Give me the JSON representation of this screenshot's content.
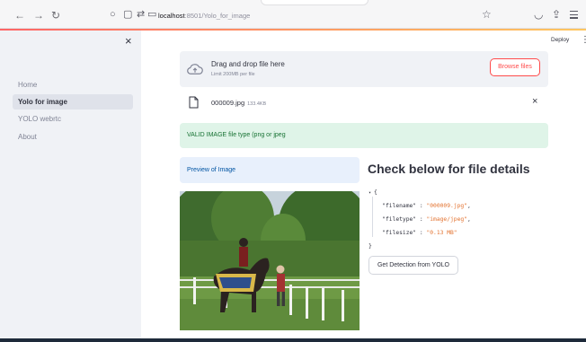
{
  "browser": {
    "url_host": "localhost",
    "url_rest": ":8501/Yolo_for_image"
  },
  "sidebar": {
    "items": [
      {
        "label": "Home",
        "active": false
      },
      {
        "label": "Yolo for image",
        "active": true
      },
      {
        "label": "YOLO webrtc",
        "active": false
      },
      {
        "label": "About",
        "active": false
      }
    ]
  },
  "header": {
    "deploy_label": "Deploy"
  },
  "uploader": {
    "title": "Drag and drop file here",
    "subtitle": "Limit 200MB per file",
    "browse_label": "Browse files"
  },
  "uploaded_file": {
    "name": "000009.jpg",
    "size": "133.4KB"
  },
  "success_message": "VALID IMAGE file type (png or jpeg",
  "preview_label": "Preview of Image",
  "details": {
    "heading": "Check below for file details",
    "open_brace": "{",
    "close_brace": "}",
    "rows": [
      {
        "key": "\"filename\"",
        "value": "\"000009.jpg\"",
        "sep": " : ",
        "comma": ","
      },
      {
        "key": "\"filetype\"",
        "value": "\"image/jpeg\"",
        "sep": " : ",
        "comma": ","
      },
      {
        "key": "\"filesize\"",
        "value": "\"0.13 MB\"",
        "sep": " : ",
        "comma": ""
      }
    ]
  },
  "detect_button_label": "Get Detection from YOLO",
  "colors": {
    "accent": "#ff4b4b",
    "success_bg": "#dff4e8",
    "info_bg": "#e8f0fc",
    "sidebar_bg": "#f0f2f6",
    "json_string": "#e3722f"
  },
  "icons": {
    "back": "back-arrow-icon",
    "forward": "forward-arrow-icon",
    "reload": "reload-icon",
    "close_sidebar": "close-icon",
    "upload": "cloud-upload-icon",
    "file": "file-icon",
    "remove": "close-icon",
    "menu": "hamburger-menu-icon",
    "bookmark": "star-icon",
    "pocket": "pocket-icon",
    "share": "share-icon"
  }
}
